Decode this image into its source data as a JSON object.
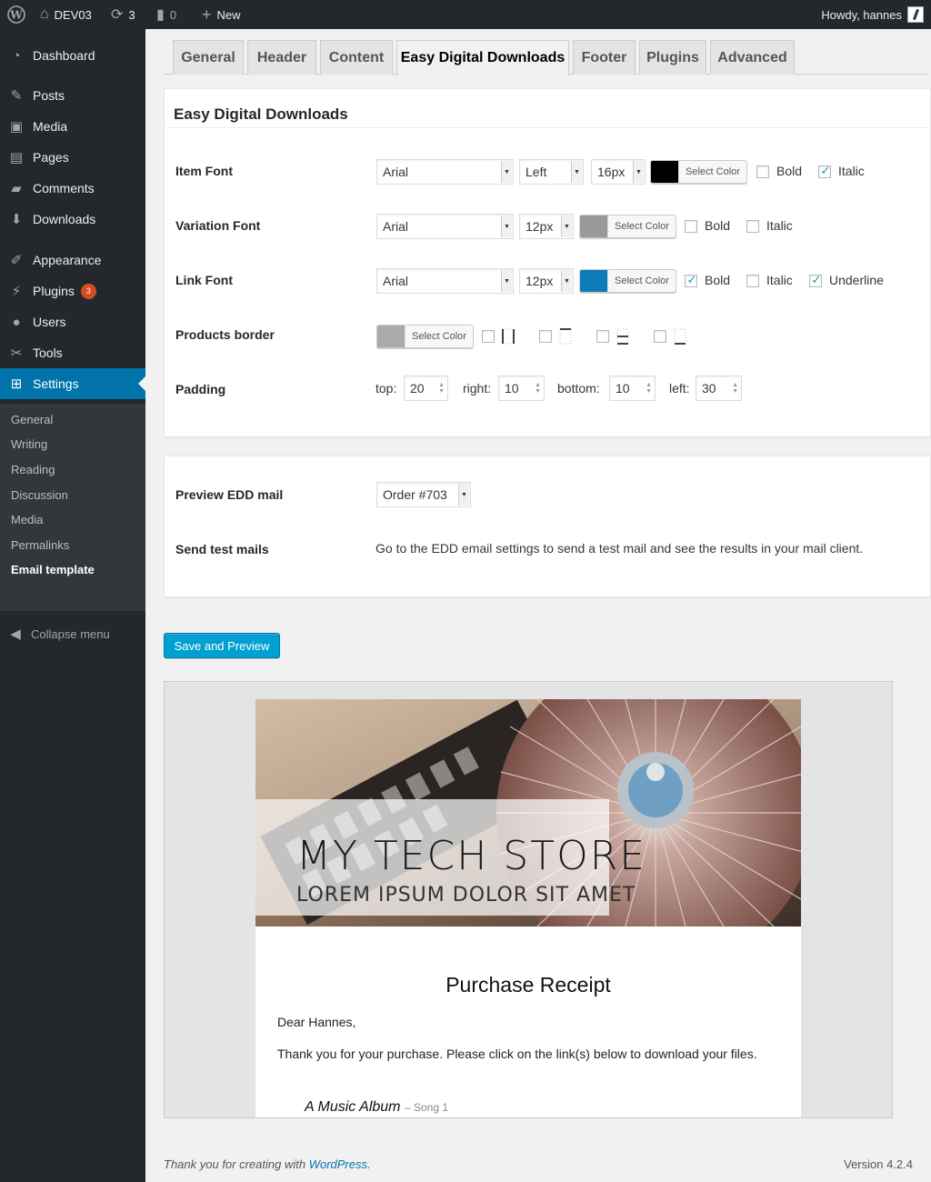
{
  "adminbar": {
    "site_name": "DEV03",
    "updates_count": "3",
    "comments_count": "0",
    "new_label": "New",
    "greeting": "Howdy, hannes"
  },
  "sidebar": {
    "items": [
      {
        "label": "Dashboard",
        "icon": "dashboard-icon"
      },
      {
        "label": "Posts",
        "icon": "pin-icon"
      },
      {
        "label": "Media",
        "icon": "media-icon"
      },
      {
        "label": "Pages",
        "icon": "pages-icon"
      },
      {
        "label": "Comments",
        "icon": "comment-icon"
      },
      {
        "label": "Downloads",
        "icon": "download-icon"
      },
      {
        "label": "Appearance",
        "icon": "brush-icon"
      },
      {
        "label": "Plugins",
        "icon": "plug-icon",
        "badge": "3"
      },
      {
        "label": "Users",
        "icon": "user-icon"
      },
      {
        "label": "Tools",
        "icon": "wrench-icon"
      },
      {
        "label": "Settings",
        "icon": "settings-icon"
      }
    ],
    "submenu": [
      "General",
      "Writing",
      "Reading",
      "Discussion",
      "Media",
      "Permalinks",
      "Email template"
    ],
    "collapse_label": "Collapse menu"
  },
  "tabs": [
    "General",
    "Header",
    "Content",
    "Easy Digital Downloads",
    "Footer",
    "Plugins",
    "Advanced"
  ],
  "edd_panel": {
    "title": "Easy Digital Downloads",
    "item_font": {
      "label": "Item Font",
      "font": "Arial",
      "align": "Left",
      "size": "16px",
      "color": "#000000",
      "color_button": "Select Color",
      "bold_label": "Bold",
      "bold": false,
      "italic_label": "Italic",
      "italic": true
    },
    "variation_font": {
      "label": "Variation Font",
      "font": "Arial",
      "size": "12px",
      "color": "#999999",
      "color_button": "Select Color",
      "bold_label": "Bold",
      "bold": false,
      "italic_label": "Italic",
      "italic": false
    },
    "link_font": {
      "label": "Link Font",
      "font": "Arial",
      "size": "12px",
      "color": "#0e7bb6",
      "color_button": "Select Color",
      "bold_label": "Bold",
      "bold": true,
      "italic_label": "Italic",
      "italic": false,
      "underline_label": "Underline",
      "underline": true
    },
    "products_border": {
      "label": "Products border",
      "color": "#aaaaaa",
      "color_button": "Select Color"
    },
    "padding": {
      "label": "Padding",
      "top_label": "top:",
      "top": "20",
      "right_label": "right:",
      "right": "10",
      "bottom_label": "bottom:",
      "bottom": "10",
      "left_label": "left:",
      "left": "30"
    }
  },
  "mail_panel": {
    "preview_label": "Preview EDD mail",
    "preview_value": "Order #703",
    "send_label": "Send test mails",
    "send_text": "Go to the EDD email settings to send a test mail and see the results in your mail client."
  },
  "save_button": "Save and Preview",
  "preview": {
    "store_title": "MY TECH STORE",
    "store_subtitle": "LOREM IPSUM DOLOR SIT AMET",
    "receipt_title": "Purchase Receipt",
    "greeting": "Dear Hannes,",
    "body": "Thank you for your purchase. Please click on the link(s) below to download your files.",
    "item": "A Music Album",
    "item_variation": "– Song 1"
  },
  "footer": {
    "thanks_prefix": "Thank you for creating with ",
    "thanks_link": "WordPress",
    "thanks_suffix": ".",
    "version": "Version 4.2.4"
  },
  "colors": {
    "accent": "#0073aa",
    "sidebar_bg": "#23282d",
    "button": "#00a0d2"
  }
}
